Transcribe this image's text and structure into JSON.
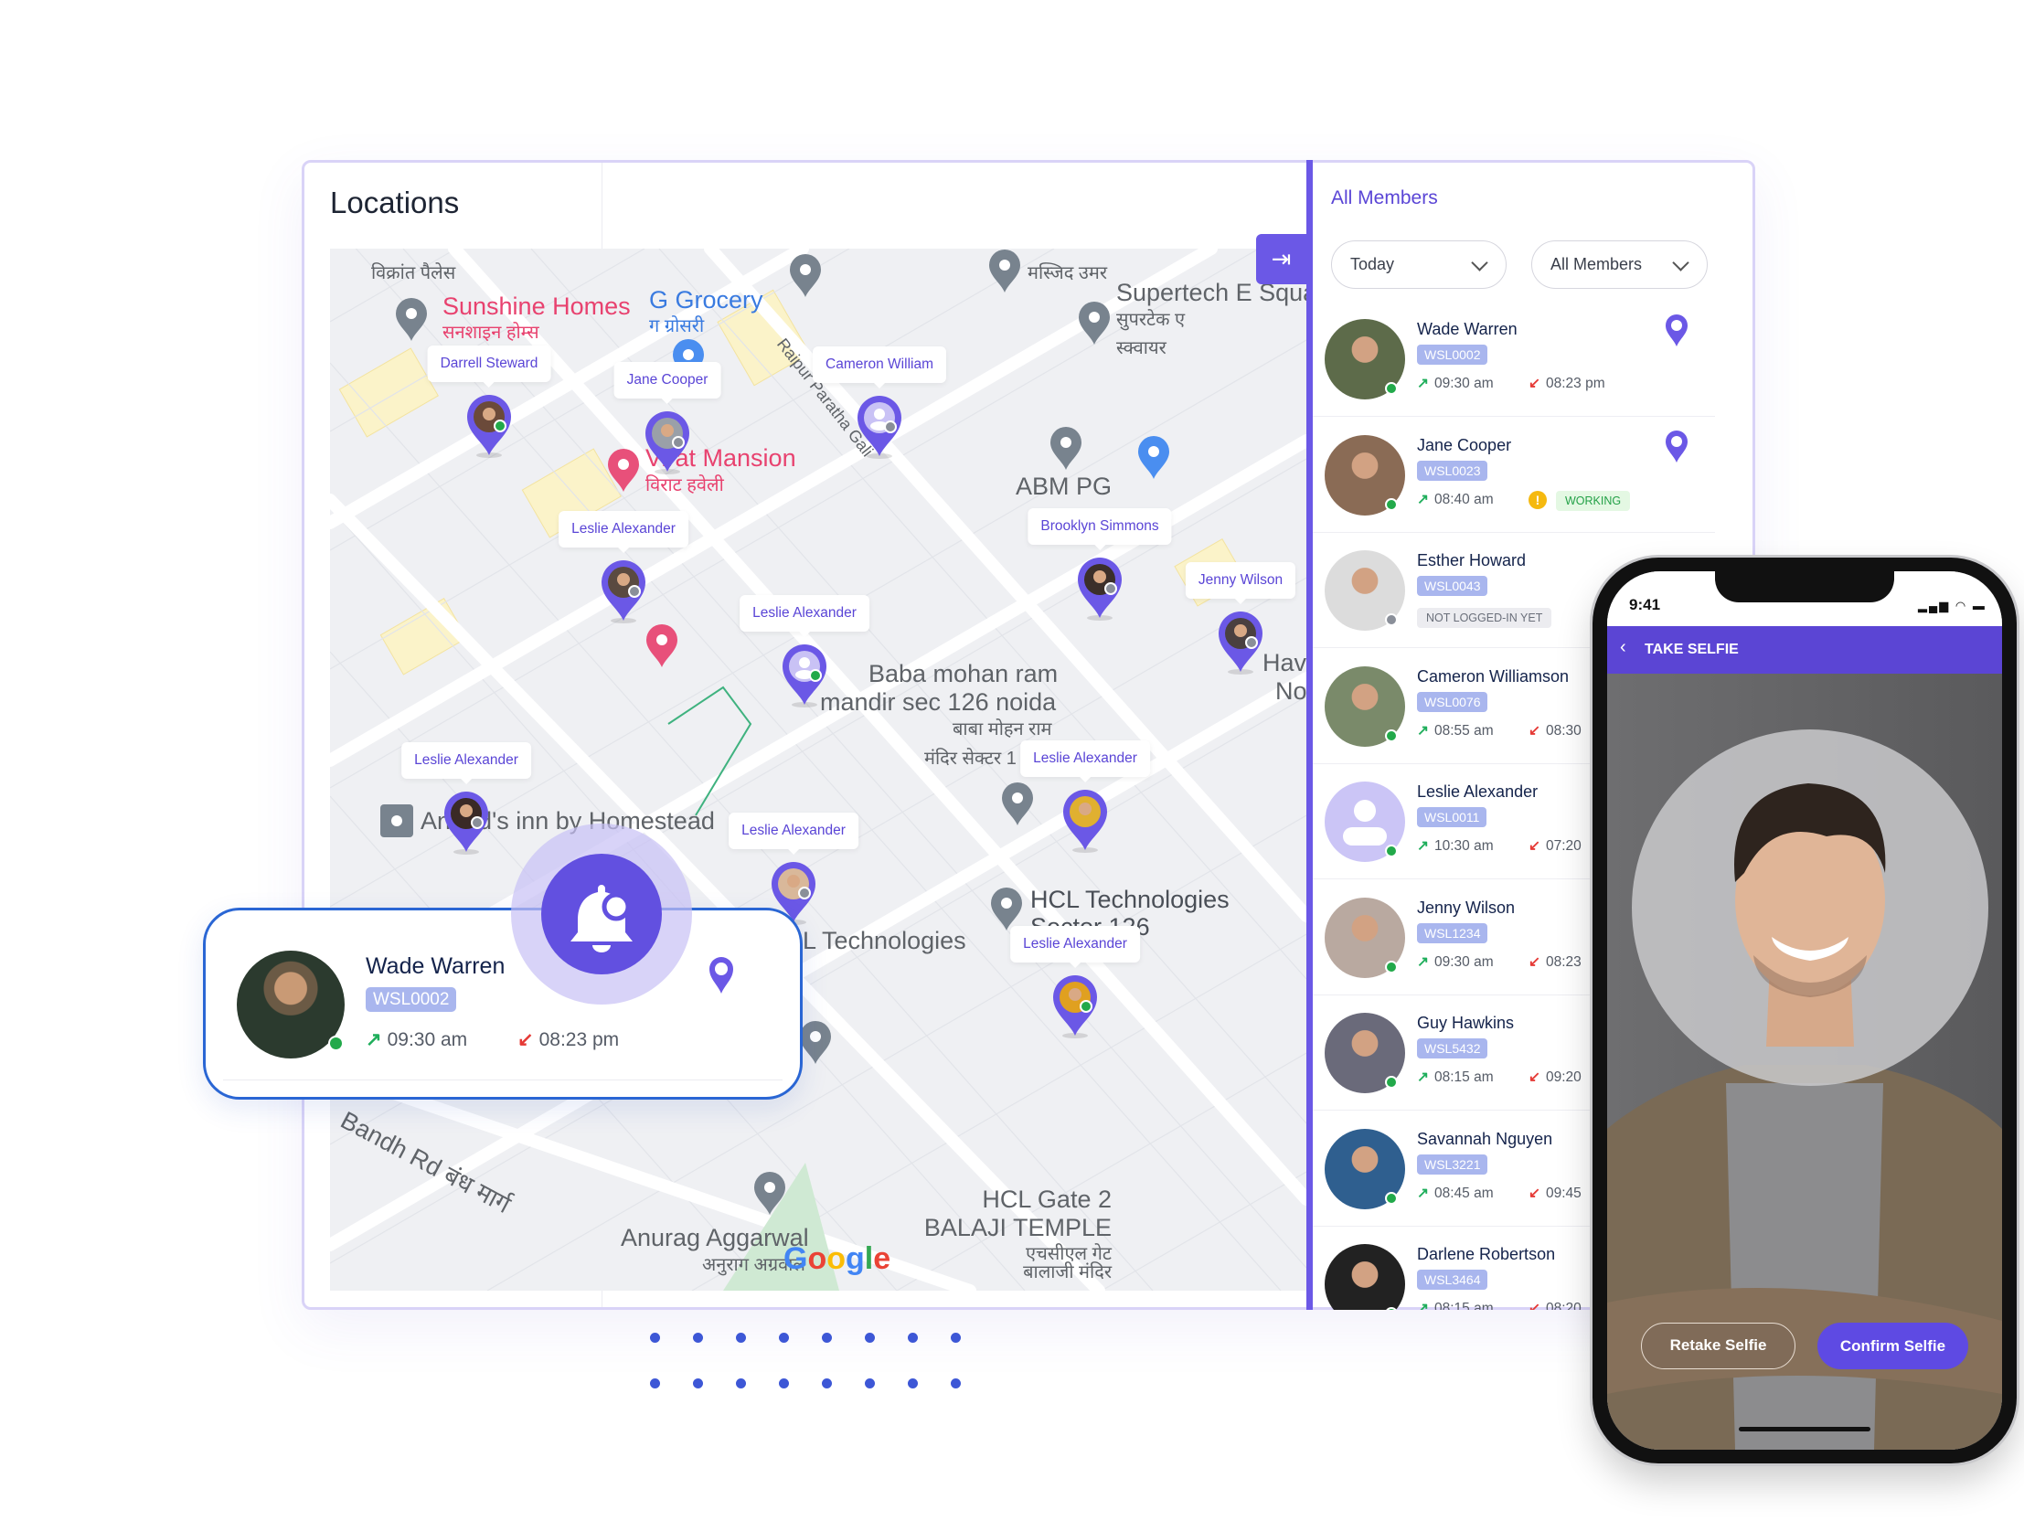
{
  "locations": {
    "title": "Locations"
  },
  "map": {
    "pins": [
      {
        "name": "Darrell Steward",
        "status": "online"
      },
      {
        "name": "Jane Cooper",
        "status": "offline"
      },
      {
        "name": "Cameron William",
        "status": "offline",
        "avatar": "placeholder"
      },
      {
        "name": "Leslie Alexander",
        "status": "offline"
      },
      {
        "name": "Leslie Alexander",
        "status": "online",
        "avatar": "placeholder"
      },
      {
        "name": "Brooklyn Simmons",
        "status": "offline"
      },
      {
        "name": "Jenny Wilson",
        "status": "offline"
      },
      {
        "name": "Leslie Alexander",
        "status": "offline"
      },
      {
        "name": "Leslie Alexander",
        "status": "none"
      },
      {
        "name": "Leslie Alexander",
        "status": "offline"
      },
      {
        "name": "Leslie Alexander",
        "status": "online"
      }
    ],
    "places": {
      "vikrant_hi": "विक्रांत पैलेस",
      "sunshine": "Sunshine Homes",
      "sunshine_hi": "सनशाइन होम्स",
      "grocery": "G Grocery",
      "grocery_hi": "ग ग्रोसरी",
      "masjid_hi": "मस्जिद उमर",
      "supertech": "Supertech E Squa",
      "supertech_hi1": "सुपरटेक ए",
      "supertech_hi2": "स्क्वायर",
      "abm": "ABM PG",
      "virat": "Virat Mansion",
      "virat_hi": "विराट हवेली",
      "raipur": "Raipur Paratha Gali",
      "baba1": "Baba mohan ram",
      "baba2": "mandir sec 126 noida",
      "baba_hi1": "बाबा मोहन राम",
      "baba_hi2": "मंदिर सेक्टर 1",
      "inn": "Anand's inn by Homestead",
      "hcl": "HCL Technologies",
      "hcl_sector": "Sector 126",
      "hcl2": "HCL Technologies",
      "hav": "Hav",
      "no": "No",
      "bandh": "Bandh Rd  बंध मार्ग",
      "anurag": "Anurag Aggarwal",
      "anurag_hi": "अनुराग अग्रवाल",
      "gate1": "HCL Gate 2",
      "gate2": "BALAJI TEMPLE",
      "gate_hi1": "एचसीएल गेट",
      "gate_hi2": "बालाजी मंदिर"
    },
    "google_logo": "Google",
    "collapse_icon": "arrow-right-to-bar-icon"
  },
  "members": {
    "title": "All Members",
    "filters": [
      {
        "label": "Today"
      },
      {
        "label": "All Members"
      }
    ],
    "list": [
      {
        "name": "Wade Warren",
        "id": "WSL0002",
        "in": "09:30 am",
        "out": "08:23 pm",
        "status": "online",
        "locate": true
      },
      {
        "name": "Jane Cooper",
        "id": "WSL0023",
        "in": "08:40 am",
        "state": "WORKING",
        "status": "online",
        "locate": true
      },
      {
        "name": "Esther Howard",
        "id": "WSL0043",
        "state": "NOT LOGGED-IN YET",
        "status": "offline"
      },
      {
        "name": "Cameron Williamson",
        "id": "WSL0076",
        "in": "08:55 am",
        "out": "08:30",
        "status": "online"
      },
      {
        "name": "Leslie Alexander",
        "id": "WSL0011",
        "in": "10:30 am",
        "out": "07:20",
        "status": "online",
        "avatar": "placeholder"
      },
      {
        "name": "Jenny Wilson",
        "id": "WSL1234",
        "in": "09:30 am",
        "out": "08:23",
        "status": "online"
      },
      {
        "name": "Guy Hawkins",
        "id": "WSL5432",
        "in": "08:15 am",
        "out": "09:20",
        "status": "online"
      },
      {
        "name": "Savannah Nguyen",
        "id": "WSL3221",
        "in": "08:45 am",
        "out": "09:45",
        "status": "online"
      },
      {
        "name": "Darlene Robertson",
        "id": "WSL3464",
        "in": "08:15 am",
        "out": "08:20",
        "status": "online"
      }
    ]
  },
  "alert_card": {
    "name": "Wade Warren",
    "id": "WSL0002",
    "in": "09:30 am",
    "out": "08:23 pm",
    "status": "online",
    "icon": "bell-icon"
  },
  "phone": {
    "time": "9:41",
    "header": "TAKE SELFIE",
    "retake": "Retake Selfie",
    "confirm": "Confirm Selfie"
  },
  "colors": {
    "accent": "#6b58e6",
    "check_in": "#1fae5b",
    "check_out": "#e53935",
    "online": "#22a94a",
    "offline": "#8a8f99",
    "badge": "#a9b6ee"
  }
}
